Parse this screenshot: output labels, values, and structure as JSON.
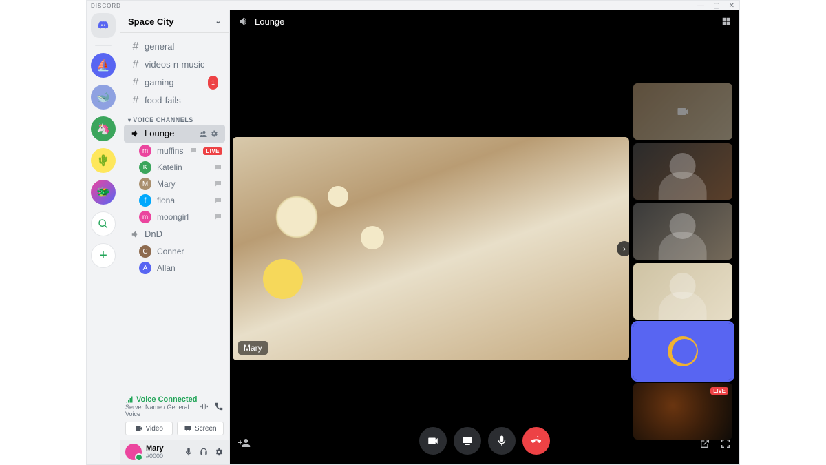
{
  "app_name": "DISCORD",
  "window": {
    "minimize": "—",
    "maximize": "▢",
    "close": "✕"
  },
  "server": {
    "name": "Space City",
    "text_channels": [
      {
        "name": "general",
        "badge": null
      },
      {
        "name": "videos-n-music",
        "badge": null
      },
      {
        "name": "gaming",
        "badge": "1"
      },
      {
        "name": "food-fails",
        "badge": null
      }
    ],
    "voice_category_label": "VOICE CHANNELS",
    "voice_channels": [
      {
        "name": "Lounge",
        "active": true,
        "members": [
          {
            "name": "muffins",
            "live": true,
            "color": "#eb459e"
          },
          {
            "name": "Katelin",
            "live": false,
            "color": "#3ba55c"
          },
          {
            "name": "Mary",
            "live": false,
            "color": "#a98f6e"
          },
          {
            "name": "fiona",
            "live": false,
            "color": "#00a8fc"
          },
          {
            "name": "moongirl",
            "live": false,
            "color": "#eb459e"
          }
        ]
      },
      {
        "name": "DnD",
        "active": false,
        "members": [
          {
            "name": "Conner",
            "live": false,
            "color": "#8e6b4f"
          },
          {
            "name": "Allan",
            "live": false,
            "color": "#5865f2"
          }
        ]
      }
    ]
  },
  "live_label": "LIVE",
  "voice_panel": {
    "status": "Voice Connected",
    "sub": "Server Name / General Voice",
    "video_btn": "Video",
    "screen_btn": "Screen"
  },
  "user": {
    "name": "Mary",
    "tag": "#0000"
  },
  "call": {
    "channel_name": "Lounge",
    "main_speaker": "Mary",
    "thumb_live_label": "LIVE"
  }
}
